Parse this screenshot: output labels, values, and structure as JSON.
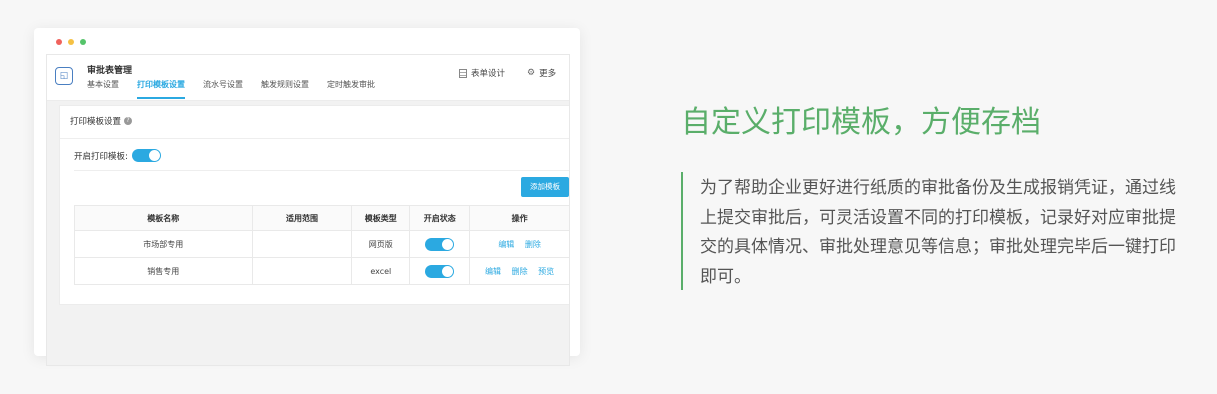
{
  "app": {
    "title": "审批表管理",
    "tabs": [
      {
        "label": "基本设置"
      },
      {
        "label": "打印模板设置"
      },
      {
        "label": "流水号设置"
      },
      {
        "label": "触发规则设置"
      },
      {
        "label": "定时触发审批"
      }
    ],
    "active_tab": 1,
    "form_design_label": "表单设计",
    "more_label": "更多"
  },
  "panel": {
    "title": "打印模板设置",
    "enable_label": "开启打印模板:",
    "enable_on": true,
    "add_button": "添加模板",
    "columns": [
      "模板名称",
      "适用范围",
      "模板类型",
      "开启状态",
      "操作"
    ],
    "rows": [
      {
        "name": "市场部专用",
        "scope": "",
        "type": "网页版",
        "enabled": true,
        "actions": [
          "编辑",
          "删除"
        ]
      },
      {
        "name": "销售专用",
        "scope": "",
        "type": "excel",
        "enabled": true,
        "actions": [
          "编辑",
          "删除",
          "预览"
        ]
      }
    ]
  },
  "feature": {
    "headline": "自定义打印模板，方便存档",
    "description": "为了帮助企业更好进行纸质的审批备份及生成报销凭证，通过线上提交审批后，可灵活设置不同的打印模板，记录好对应审批提交的具体情况、审批处理意见等信息；审批处理完毕后一键打印即可。"
  },
  "colors": {
    "accent": "#2ba9e1",
    "headline": "#5aae6a"
  }
}
